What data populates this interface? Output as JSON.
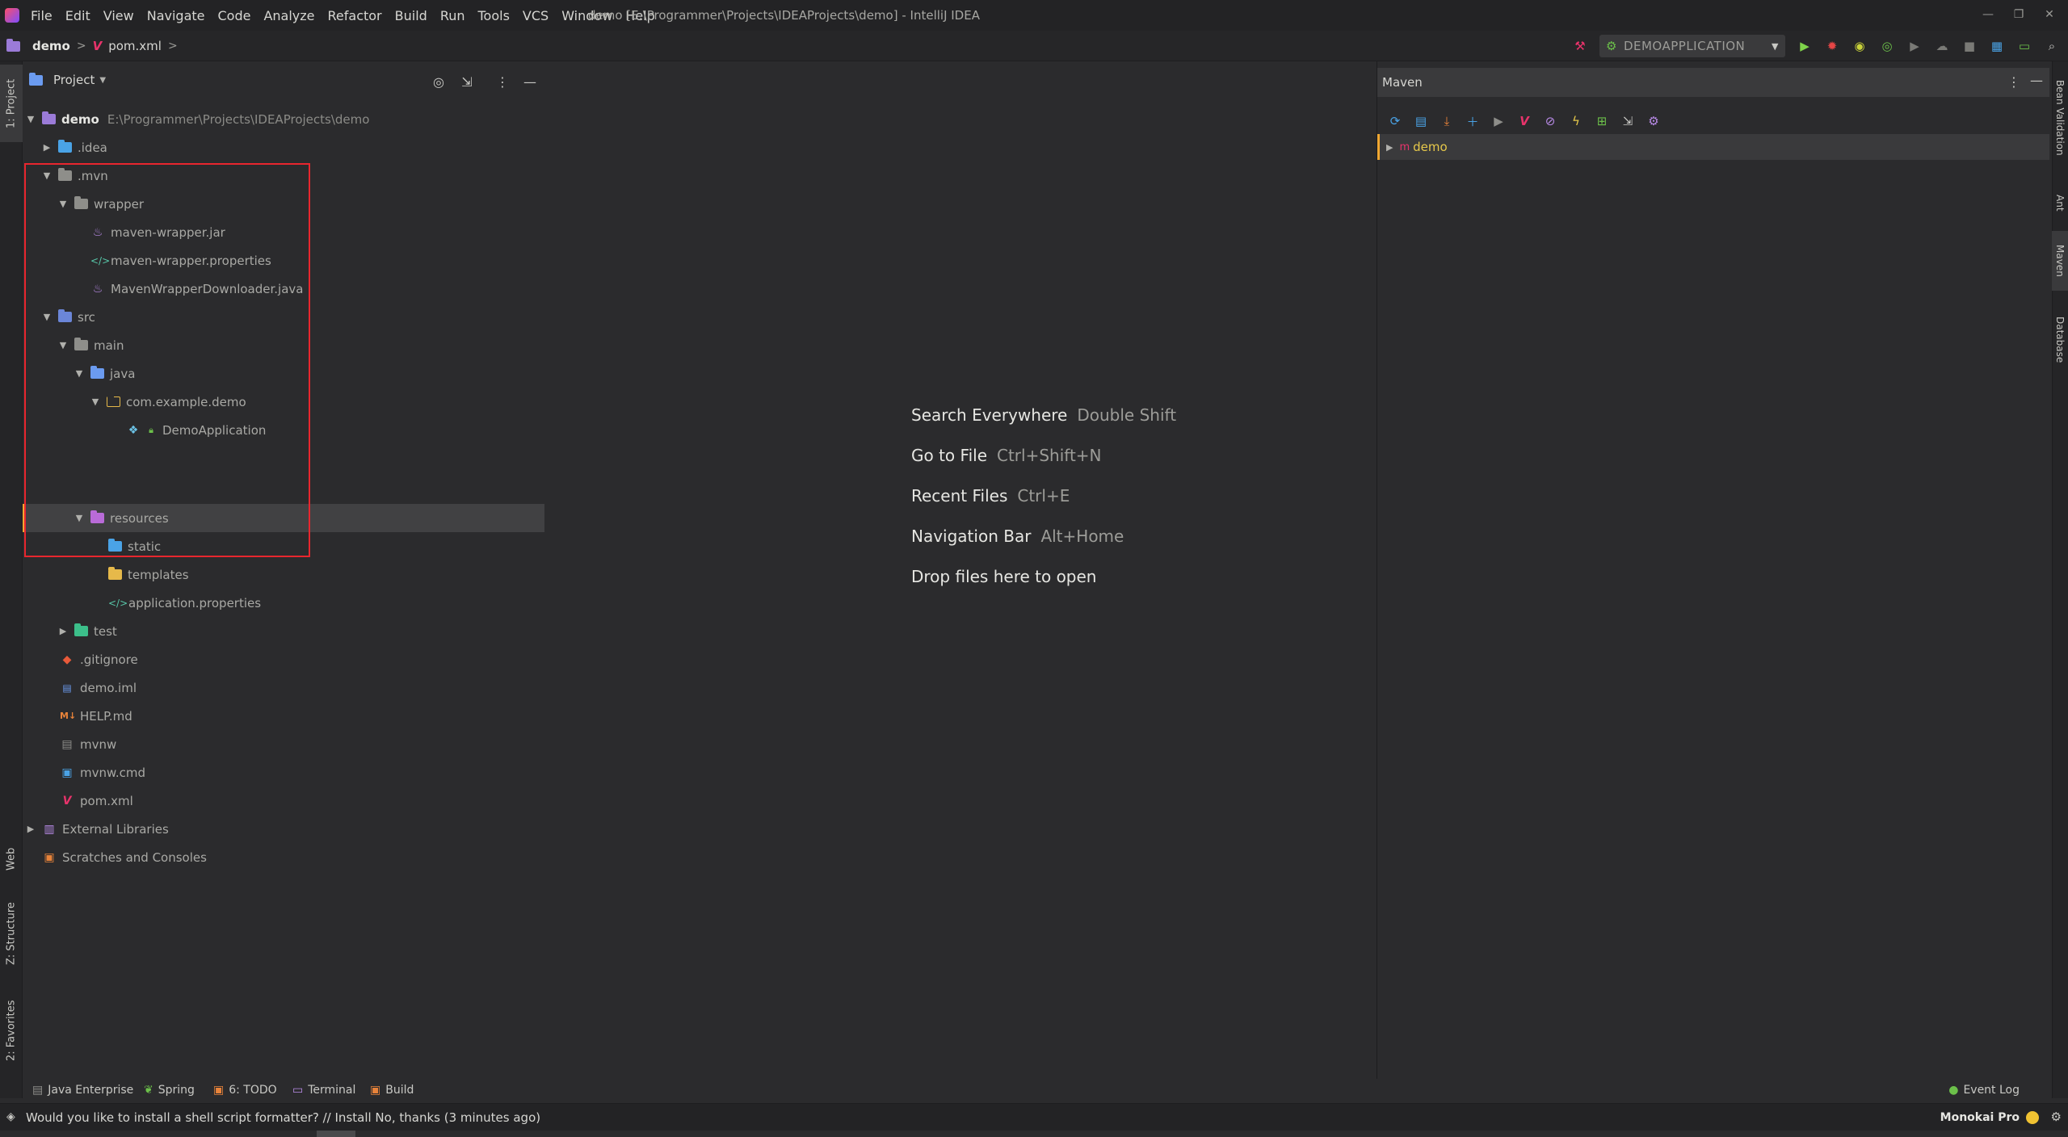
{
  "window": {
    "menus": [
      "File",
      "Edit",
      "View",
      "Navigate",
      "Code",
      "Analyze",
      "Refactor",
      "Build",
      "Run",
      "Tools",
      "VCS",
      "Window",
      "Help"
    ],
    "title": "demo [E:\\Programmer\\Projects\\IDEAProjects\\demo] - IntelliJ IDEA"
  },
  "breadcrumb": {
    "project": "demo",
    "file": "pom.xml"
  },
  "run_toolbar": {
    "config": "DEMOAPPLICATION"
  },
  "left_strip": {
    "tabs": [
      "1: Project",
      "Web",
      "Z: Structure",
      "2: Favorites"
    ]
  },
  "right_strip": {
    "tabs": [
      "Bean Validation",
      "Ant",
      "Maven",
      "Database"
    ]
  },
  "project_panel": {
    "title": "Project",
    "tree": [
      {
        "label": "demo",
        "hint": "E:\\Programmer\\Projects\\IDEAProjects\\demo"
      },
      {
        "label": ".idea"
      },
      {
        "label": ".mvn"
      },
      {
        "label": "wrapper"
      },
      {
        "label": "maven-wrapper.jar"
      },
      {
        "label": "maven-wrapper.properties"
      },
      {
        "label": "MavenWrapperDownloader.java"
      },
      {
        "label": "src"
      },
      {
        "label": "main"
      },
      {
        "label": "java"
      },
      {
        "label": "com.example.demo"
      },
      {
        "label": "DemoApplication"
      },
      {
        "label": "resources"
      },
      {
        "label": "static"
      },
      {
        "label": "templates"
      },
      {
        "label": "application.properties"
      },
      {
        "label": "test"
      },
      {
        "label": ".gitignore"
      },
      {
        "label": "demo.iml"
      },
      {
        "label": "HELP.md"
      },
      {
        "label": "mvnw"
      },
      {
        "label": "mvnw.cmd"
      },
      {
        "label": "pom.xml"
      },
      {
        "label": "External Libraries"
      },
      {
        "label": "Scratches and Consoles"
      }
    ]
  },
  "editor_hints": [
    {
      "action": "Search Everywhere",
      "shortcut": "Double Shift"
    },
    {
      "action": "Go to File",
      "shortcut": "Ctrl+Shift+N"
    },
    {
      "action": "Recent Files",
      "shortcut": "Ctrl+E"
    },
    {
      "action": "Navigation Bar",
      "shortcut": "Alt+Home"
    },
    {
      "action": "Drop files here to open",
      "shortcut": ""
    }
  ],
  "maven_panel": {
    "title": "Maven",
    "root": "demo"
  },
  "bottom_tabs": [
    "Java Enterprise",
    "Spring",
    "6: TODO",
    "Terminal",
    "Build"
  ],
  "event_log": "Event Log",
  "status": {
    "message": "Would you like to install a shell script formatter? // Install   No, thanks (3 minutes ago)",
    "theme": "Monokai Pro"
  },
  "colors": {
    "accent_selected": "#f0a732",
    "highlight_box": "#e8262e",
    "folder_blue": "#6b9bf0",
    "folder_gray": "#8e8e8a"
  }
}
